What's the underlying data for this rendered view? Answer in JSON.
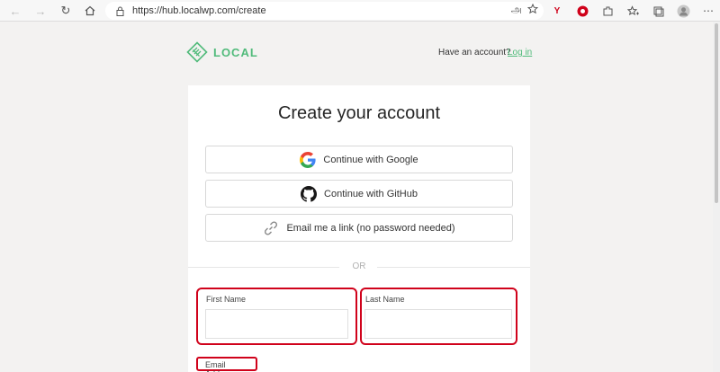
{
  "browser": {
    "url": "https://hub.localwp.com/create",
    "translate_icon": "அ"
  },
  "header": {
    "logo_text": "LOCAL",
    "have_account": "Have an account?",
    "login_link": "Log in"
  },
  "card": {
    "title": "Create your account",
    "google_button": "Continue with Google",
    "github_button": "Continue with GitHub",
    "email_link_button": "Email me a link (no password needed)",
    "divider_text": "OR",
    "first_name_label": "First Name",
    "last_name_label": "Last Name",
    "email_label": "Email Address"
  },
  "colors": {
    "brand": "#51bb7b",
    "highlight": "#d0021b"
  }
}
